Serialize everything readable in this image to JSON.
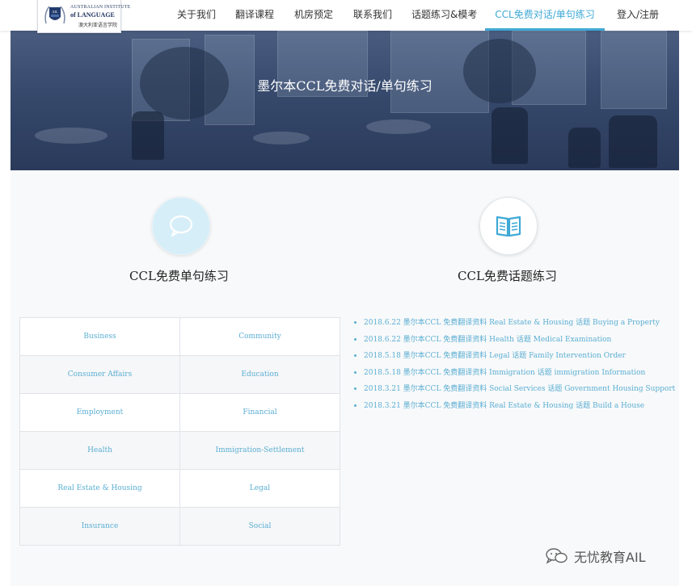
{
  "logo": {
    "line1": "AUSTRALIAN INSTITUTE",
    "line2": "of LANGUAGE",
    "line3": "澳大利亚语言学院"
  },
  "nav": {
    "items": [
      {
        "label": "关于我们"
      },
      {
        "label": "翻译课程"
      },
      {
        "label": "机房预定"
      },
      {
        "label": "联系我们"
      },
      {
        "label": "话题练习&模考"
      },
      {
        "label": "CCL免费对话/单句练习",
        "active": true
      },
      {
        "label": "登入/注册"
      }
    ]
  },
  "banner": {
    "title": "墨尔本CCL免费对话/单句练习"
  },
  "sections": {
    "left_title": "CCL免费单句练习",
    "right_title": "CCL免费话题练习",
    "left_icon": "speech-bubble-icon",
    "right_icon": "open-book-icon"
  },
  "categories": [
    [
      "Business",
      "Community"
    ],
    [
      "Consumer Affairs",
      "Education"
    ],
    [
      "Employment",
      "Financial"
    ],
    [
      "Health",
      "Immigration-Settlement"
    ],
    [
      "Real Estate & Housing",
      "Legal"
    ],
    [
      "Insurance",
      "Social"
    ]
  ],
  "topics": [
    "2018.6.22 墨尔本CCL 免费翻译资料 Real Estate & Housing 话题 Buying a Property",
    "2018.6.22 墨尔本CCL 免费翻译资料 Health 话题 Medical Examination",
    "2018.5.18 墨尔本CCL 免费翻译资料 Legal 话题 Family Intervention Order",
    "2018.5.18 墨尔本CCL 免费翻译资料 Immigration 话题 immigration Information",
    "2018.3.21 墨尔本CCL 免费翻译资料 Social Services 话题 Government Housing Support",
    "2018.3.21 墨尔本CCL 免费翻译资料 Real Estate & Housing 话题 Build a House"
  ],
  "watermark": {
    "text": "无忧教育AIL"
  },
  "colors": {
    "accent": "#3fa9d6",
    "link": "#5aaed3",
    "banner": "#2f4266"
  }
}
